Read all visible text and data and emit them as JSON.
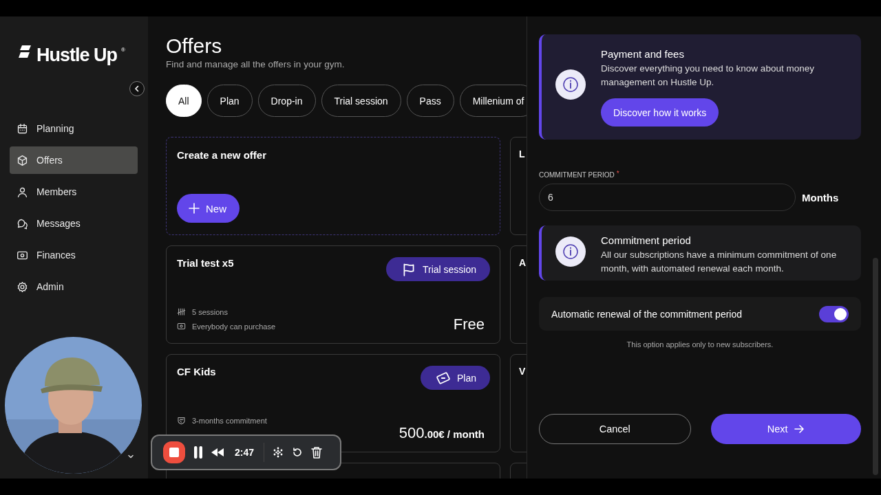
{
  "sidebar": {
    "logo": {
      "text": "Hustle Up",
      "mark": "®"
    },
    "items": [
      {
        "label": "Planning",
        "selected": false
      },
      {
        "label": "Offers",
        "selected": true
      },
      {
        "label": "Members",
        "selected": false
      },
      {
        "label": "Messages",
        "selected": false
      },
      {
        "label": "Finances",
        "selected": false
      },
      {
        "label": "Admin",
        "selected": false
      }
    ]
  },
  "main": {
    "title": "Offers",
    "subtitle": "Find and manage all the offers in your gym.",
    "filters": [
      {
        "label": "All",
        "selected": true
      },
      {
        "label": "Plan",
        "selected": false
      },
      {
        "label": "Drop-in",
        "selected": false
      },
      {
        "label": "Trial session",
        "selected": false
      },
      {
        "label": "Pass",
        "selected": false
      },
      {
        "label": "Millenium of",
        "selected": false
      }
    ],
    "create_card": {
      "title": "Create a new offer",
      "button": "New"
    },
    "offers": [
      {
        "title": "Trial test x5",
        "kind": "trial",
        "badge": "Trial session",
        "details": [
          {
            "kind": "sessions",
            "text": "5 sessions"
          },
          {
            "kind": "audience",
            "text": "Everybody can purchase"
          }
        ],
        "price": "Free"
      },
      {
        "title": "CF Kids",
        "kind": "plan",
        "badge": "Plan",
        "details": [
          {
            "kind": "commitment",
            "text": "3-months commitment"
          }
        ],
        "price": "500",
        "price_suffix": ".00€ / month"
      }
    ],
    "side_cards": [
      {
        "title": "L"
      },
      {
        "title": "A"
      },
      {
        "title": "V"
      }
    ]
  },
  "panel": {
    "info_cards": [
      {
        "title": "Payment and fees",
        "text": "Discover everything you need to know about money management on Hustle Up.",
        "button": "Discover how it works"
      },
      {
        "title": "Commitment period",
        "text": "All our subscriptions have a minimum commitment of one month, with automated renewal each month."
      }
    ],
    "field": {
      "label": "COMMITMENT PERIOD",
      "required_mark": "*",
      "value": "6",
      "unit": "Months"
    },
    "toggle": {
      "label": "Automatic renewal of the commitment period",
      "on": true
    },
    "note": "This option applies only to new subscribers.",
    "buttons": [
      {
        "label": "Cancel",
        "kind": "secondary"
      },
      {
        "label": "Next",
        "kind": "primary"
      }
    ]
  },
  "recorder": {
    "time": "2:47"
  }
}
